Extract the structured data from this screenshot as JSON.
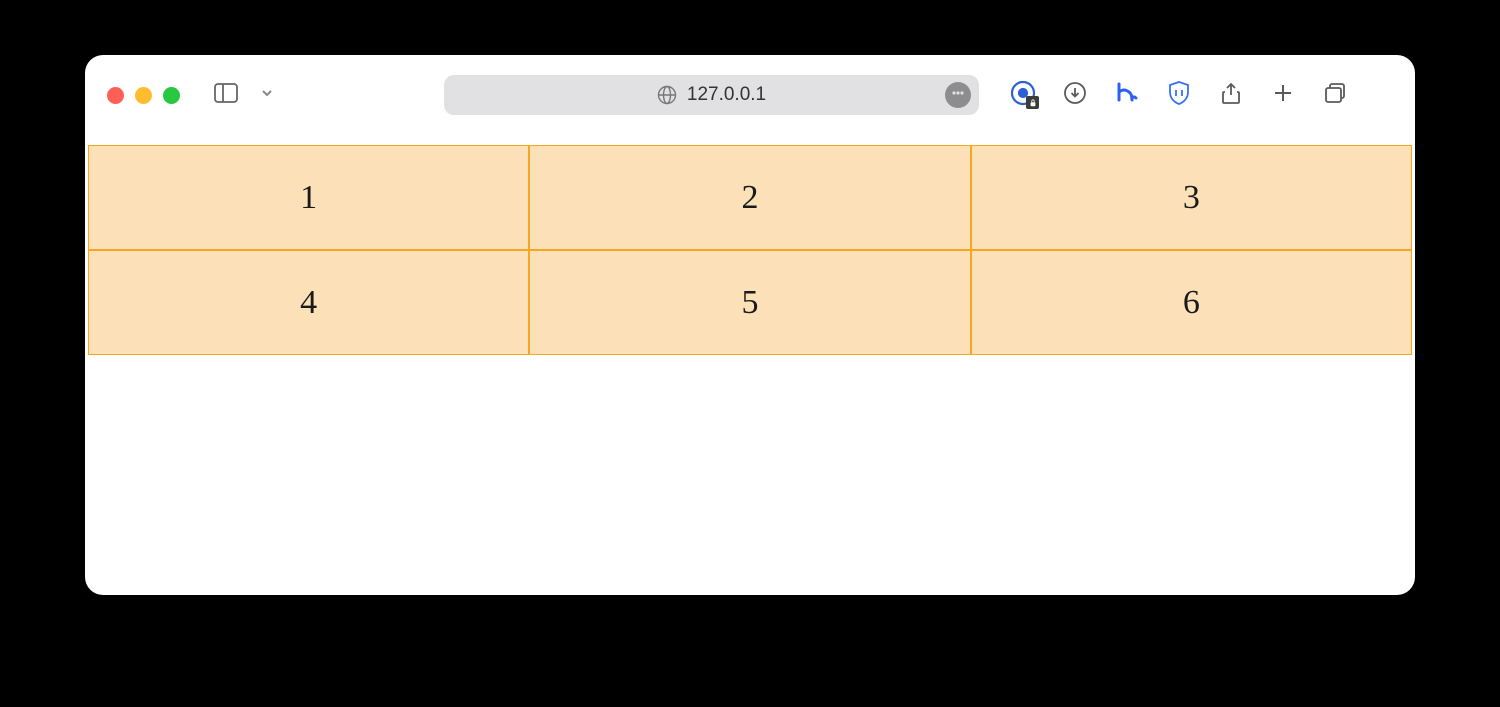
{
  "address": "127.0.0.1",
  "grid": {
    "cells": [
      "1",
      "2",
      "3",
      "4",
      "5",
      "6"
    ]
  }
}
